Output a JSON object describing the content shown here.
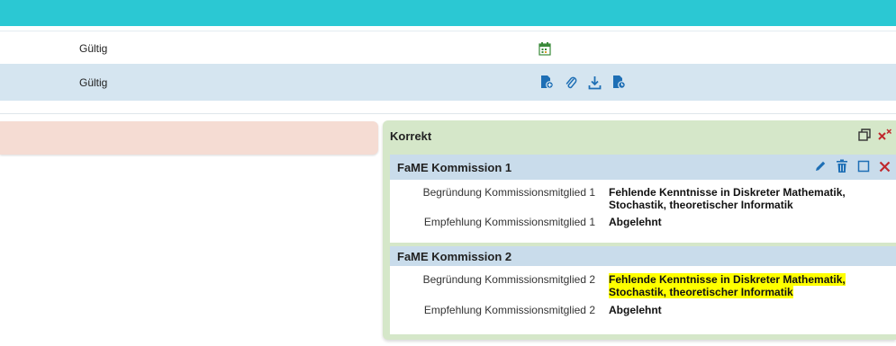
{
  "rows": [
    {
      "status": "Gültig"
    },
    {
      "status": "Gültig"
    }
  ],
  "panel": {
    "title": "Korrekt",
    "cards": [
      {
        "title": "FaME Kommission 1",
        "fields": [
          {
            "label": "Begründung Kommissionsmitglied 1",
            "value": "Fehlende Kenntnisse in Diskreter Mathematik, Stochastik, theoretischer Informatik"
          },
          {
            "label": "Empfehlung Kommissionsmitglied 1",
            "value": "Abgelehnt"
          }
        ]
      },
      {
        "title": "FaME Kommission 2",
        "fields": [
          {
            "label": "Begründung Kommissionsmitglied 2",
            "value_line1": "Fehlende Kenntnisse in Diskreter Mathematik,",
            "value_line2": "Stochastik, theoretischer Informatik"
          },
          {
            "label": "Empfehlung Kommissionsmitglied 2",
            "value": "Abgelehnt"
          }
        ]
      }
    ]
  },
  "colors": {
    "topbar": "#2bc8d3",
    "row_highlight": "#d5e5f0",
    "panel_bg": "#d5e7c9",
    "card_header": "#c9dceb",
    "pink_bar": "#f5dcd3",
    "icon_blue": "#1e6fb5",
    "close_red": "#c0282d",
    "text_highlight": "#ffff00"
  },
  "icons": [
    "calendar-icon",
    "document-add-icon",
    "paperclip-icon",
    "download-icon",
    "document-clock-icon",
    "restore-window-icon",
    "close-all-icon",
    "edit-icon",
    "trash-icon",
    "maximize-icon",
    "close-icon"
  ]
}
